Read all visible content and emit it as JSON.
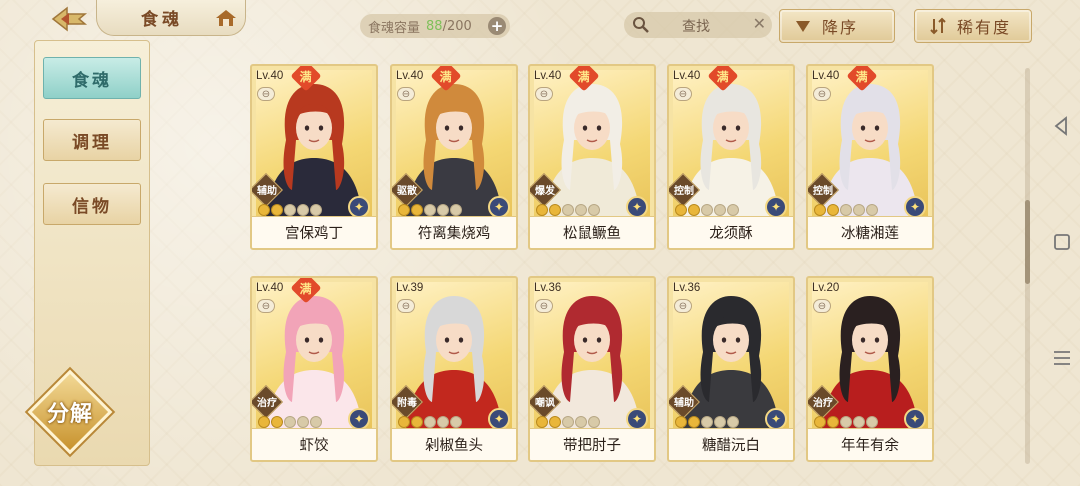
{
  "header": {
    "title": "食魂",
    "capacity_label": "食魂容量",
    "capacity_current": "88",
    "capacity_total": "/200",
    "capacity_plus": "+",
    "search_placeholder": "查找",
    "sort_order_label": "降序",
    "sort_by_label": "稀有度"
  },
  "sidebar": {
    "tabs": [
      {
        "label": "食魂",
        "active": true
      },
      {
        "label": "调理",
        "active": false
      },
      {
        "label": "信物",
        "active": false
      }
    ],
    "decompose_label": "分解"
  },
  "cards": [
    {
      "level": "Lv.40",
      "full": "满",
      "role": "辅助",
      "stars": 5,
      "name": "宫保鸡丁",
      "hair": "#b8391f",
      "coat": "#2a2a3a"
    },
    {
      "level": "Lv.40",
      "full": "满",
      "role": "驱散",
      "stars": 5,
      "name": "符离集烧鸡",
      "hair": "#d08a3c",
      "coat": "#3a3a42"
    },
    {
      "level": "Lv.40",
      "full": "满",
      "role": "爆发",
      "stars": 5,
      "name": "松鼠鳜鱼",
      "hair": "#f2eee6",
      "coat": "#f0ead8"
    },
    {
      "level": "Lv.40",
      "full": "满",
      "role": "控制",
      "stars": 5,
      "name": "龙须酥",
      "hair": "#e8e6e0",
      "coat": "#f6f2e6"
    },
    {
      "level": "Lv.40",
      "full": "满",
      "role": "控制",
      "stars": 5,
      "name": "冰糖湘莲",
      "hair": "#e2e0e8",
      "coat": "#ece6ee"
    },
    {
      "level": "Lv.40",
      "full": "满",
      "role": "治疗",
      "stars": 5,
      "name": "虾饺",
      "hair": "#f2a4b8",
      "coat": "#fbe6ea"
    },
    {
      "level": "Lv.39",
      "full": "",
      "role": "附毒",
      "stars": 5,
      "name": "剁椒鱼头",
      "hair": "#d8d8d8",
      "coat": "#c2281e"
    },
    {
      "level": "Lv.36",
      "full": "",
      "role": "嘲讽",
      "stars": 5,
      "name": "带把肘子",
      "hair": "#b02a30",
      "coat": "#f2e8dc"
    },
    {
      "level": "Lv.36",
      "full": "",
      "role": "辅助",
      "stars": 5,
      "name": "糖醋沅白",
      "hair": "#2a2a2e",
      "coat": "#3a3a3e"
    },
    {
      "level": "Lv.20",
      "full": "",
      "role": "治疗",
      "stars": 5,
      "name": "年年有余",
      "hair": "#2a2020",
      "coat": "#b81e1e"
    }
  ],
  "colors": {
    "accent_active": "#8fd0c8",
    "gold": "#e9b63a",
    "full_badge": "#e24a2a"
  },
  "icons": [
    "back-arrow-icon",
    "home-icon",
    "search-icon",
    "clear-icon",
    "sort-desc-icon",
    "sort-rarity-icon",
    "lock-icon",
    "element-icon",
    "nav-back-icon",
    "nav-home-icon",
    "nav-menu-icon"
  ]
}
